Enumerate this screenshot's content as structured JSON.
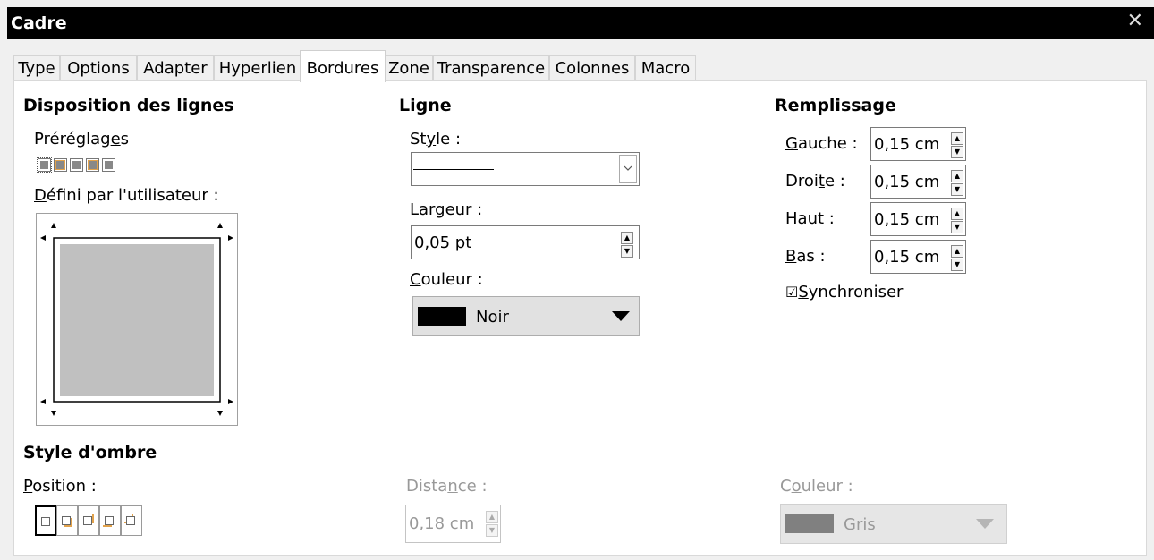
{
  "window": {
    "title": "Cadre",
    "close_glyph": "✕"
  },
  "tabs": [
    {
      "label": "Type"
    },
    {
      "label": "Options"
    },
    {
      "label": "Adapter"
    },
    {
      "label": "Hyperlien"
    },
    {
      "label": "Bordures",
      "active": true
    },
    {
      "label": "Zone"
    },
    {
      "label": "Transparence"
    },
    {
      "label": "Colonnes"
    },
    {
      "label": "Macro"
    }
  ],
  "disposition": {
    "heading": "Disposition des lignes",
    "presets_label_pre": "Préréglag",
    "presets_label_u": "e",
    "presets_label_post": "s",
    "user_label_u": "D",
    "user_label_post": "éfini par l'utilisateur :"
  },
  "ligne": {
    "heading": "Ligne",
    "style_label_pre": "St",
    "style_label_u": "y",
    "style_label_post": "le :",
    "width_label_u": "L",
    "width_label_post": "argeur :",
    "width_value": "0,05 pt",
    "color_label_u": "C",
    "color_label_post": "ouleur :",
    "color_value": "Noir",
    "color_hex": "#000000"
  },
  "remplissage": {
    "heading": "Remplissage",
    "rows": [
      {
        "u": "G",
        "post": "auche :",
        "value": "0,15 cm"
      },
      {
        "u": "",
        "pre": "Droi",
        "mid": "t",
        "post": "e :",
        "value": "0,15 cm"
      },
      {
        "u": "H",
        "post": "aut :",
        "value": "0,15 cm"
      },
      {
        "u": "B",
        "post": "as :",
        "value": "0,15 cm"
      }
    ],
    "sync_check": "☑",
    "sync_u": "S",
    "sync_post": "ynchroniser"
  },
  "ombre": {
    "heading": "Style d'ombre",
    "position_u": "P",
    "position_post": "osition :",
    "distance_pre": "Dista",
    "distance_u": "n",
    "distance_post": "ce :",
    "distance_value": "0,18 cm",
    "color_pre": "C",
    "color_u": "o",
    "color_post": "uleur :",
    "color_value": "Gris",
    "color_hex": "#808080"
  },
  "colors": {
    "accent_shadow": "#e2a24b",
    "panel_bg": "#ffffff",
    "dialog_bg": "#f0f0f0"
  }
}
